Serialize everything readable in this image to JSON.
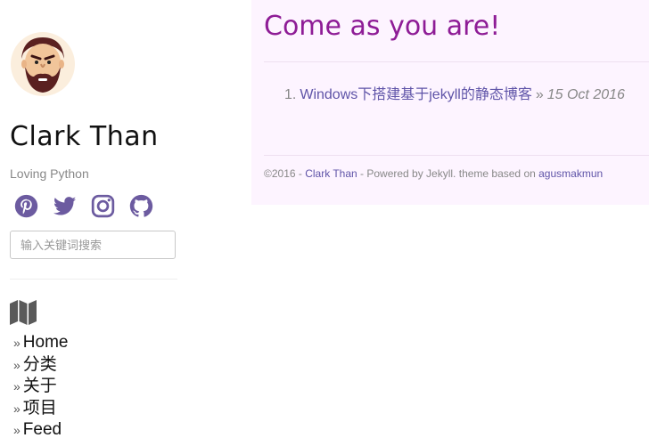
{
  "sidebar": {
    "avatar_alt": "avatar",
    "title": "Clark Than",
    "tagline": "Loving Python",
    "social": [
      {
        "icon": "pinterest-icon"
      },
      {
        "icon": "twitter-icon"
      },
      {
        "icon": "instagram-icon"
      },
      {
        "icon": "github-icon"
      }
    ],
    "search": {
      "placeholder": "输入关键词搜索"
    },
    "nav_icon": "map-icon",
    "nav": [
      {
        "marker": "»",
        "label": "Home"
      },
      {
        "marker": "»",
        "label": "分类"
      },
      {
        "marker": "»",
        "label": "关于"
      },
      {
        "marker": "»",
        "label": "项目"
      },
      {
        "marker": "»",
        "label": "Feed"
      }
    ]
  },
  "main": {
    "heading": "Come as you are!",
    "posts": [
      {
        "number": "1.",
        "title": "Windows下搭建基于jekyll的静态博客",
        "separator": "»",
        "date": "15 Oct 2016"
      }
    ]
  },
  "footer": {
    "copyright": "©2016 - ",
    "author": "Clark Than",
    "powered": " - Powered by Jekyll. theme based on ",
    "theme_author": "agusmakmun"
  },
  "colors": {
    "accent": "#8e1c96",
    "link": "#5f54a8",
    "content_bg": "#fdf4ff"
  }
}
